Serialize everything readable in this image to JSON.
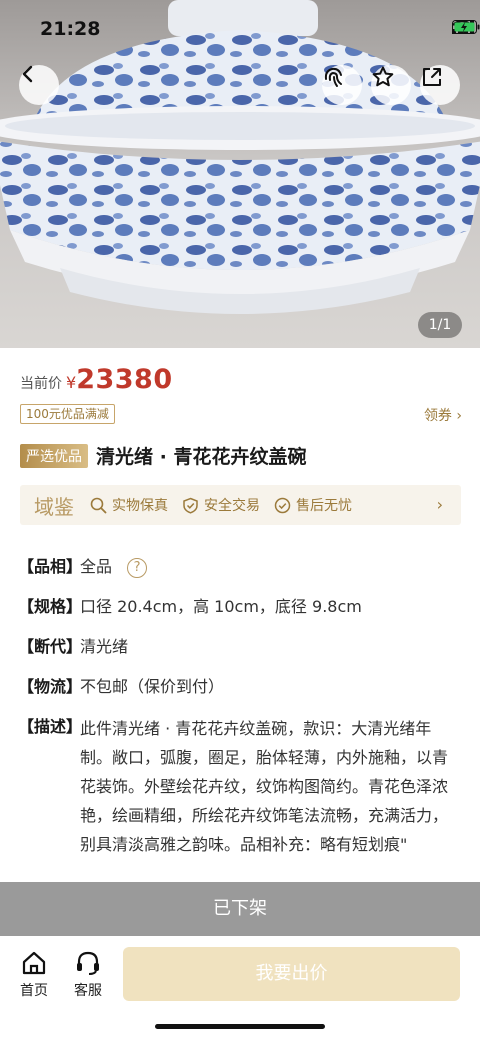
{
  "status_bar": {
    "time": "21:28"
  },
  "gallery": {
    "page_indicator": "1/1"
  },
  "price": {
    "label": "当前价",
    "currency": "¥",
    "value": "23380"
  },
  "coupon": {
    "tag": "100元优品满减",
    "link": "领券 ›"
  },
  "product": {
    "badge": "严选优品",
    "title": "清光绪 · 青花花卉纹盖碗"
  },
  "assurance": {
    "brand": "域鉴",
    "items": [
      "实物保真",
      "安全交易",
      "售后无忧"
    ],
    "arrow": "›"
  },
  "specs": [
    {
      "key": "【品相】",
      "value": "全品"
    },
    {
      "key": "【规格】",
      "value": "口径 20.4cm，高 10cm，底径 9.8cm"
    },
    {
      "key": "【断代】",
      "value": "清光绪"
    },
    {
      "key": "【物流】",
      "value": "不包邮（保价到付）"
    },
    {
      "key": "【描述】",
      "value": "此件清光绪 · 青花花卉纹盖碗，款识：大清光绪年制。敞口，弧腹，圈足，胎体轻薄，内外施釉，以青花装饰。外壁绘花卉纹，纹饰构图简约。青花色泽浓艳，绘画精细，所绘花卉纹饰笔法流畅，充满活力，别具清淡高雅之韵味。品相补充：略有短划痕\""
    }
  ],
  "help_icon_glyph": "?",
  "status": {
    "off_shelf": "已下架"
  },
  "bottom_nav": {
    "home": "首页",
    "service": "客服",
    "bid": "我要出价"
  },
  "colors": {
    "accent_gold": "#b89a64",
    "price_red": "#c0392b",
    "disabled_bid": "#f0e2bf",
    "off_shelf_bg": "#9a9a9a"
  }
}
